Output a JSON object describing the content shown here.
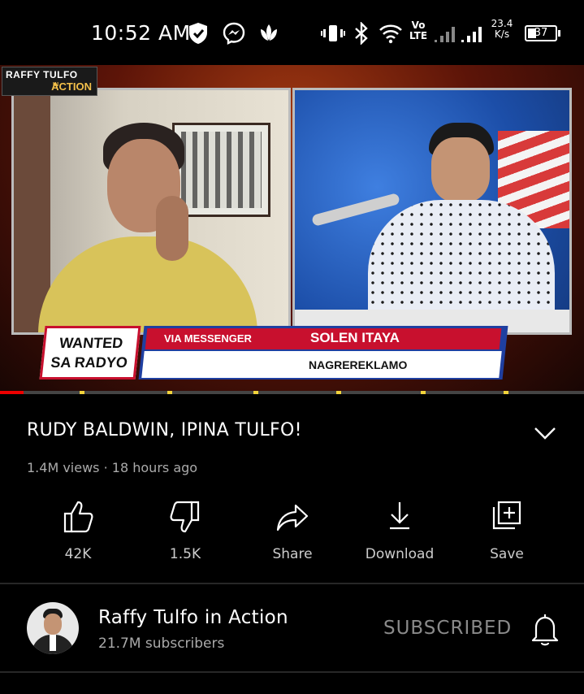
{
  "status_bar": {
    "time": "10:52 AM",
    "volte_top": "Vo",
    "volte_bottom": "LTE",
    "net_speed_value": "23.4",
    "net_speed_unit": "K/s",
    "battery": "37"
  },
  "video": {
    "logo_main": "RAFFY TULFO",
    "logo_sub": "ACTION",
    "logo_in": "IN",
    "segment_line1": "WANTED",
    "segment_line2": "SA RADYO",
    "via_label": "VIA MESSENGER",
    "caller_name": "SOLEN ITAYA",
    "caller_role": "NAGREREKLAMO",
    "progress_fraction": 0.04
  },
  "details": {
    "title": "RUDY BALDWIN, IPINA TULFO!",
    "views": "1.4M views",
    "separator": "·",
    "age": "18 hours ago"
  },
  "actions": [
    {
      "icon": "thumbs-up-icon",
      "label": "42K"
    },
    {
      "icon": "thumbs-down-icon",
      "label": "1.5K"
    },
    {
      "icon": "share-icon",
      "label": "Share"
    },
    {
      "icon": "download-icon",
      "label": "Download"
    },
    {
      "icon": "save-playlist-icon",
      "label": "Save"
    }
  ],
  "channel": {
    "name": "Raffy Tulfo in Action",
    "subscribers": "21.7M subscribers",
    "subscribe_state": "SUBSCRIBED"
  },
  "colors": {
    "background": "#000000",
    "progress_red": "#ff0000",
    "ad_marker": "#f2d33b",
    "lower_third_red": "#c8102e"
  }
}
